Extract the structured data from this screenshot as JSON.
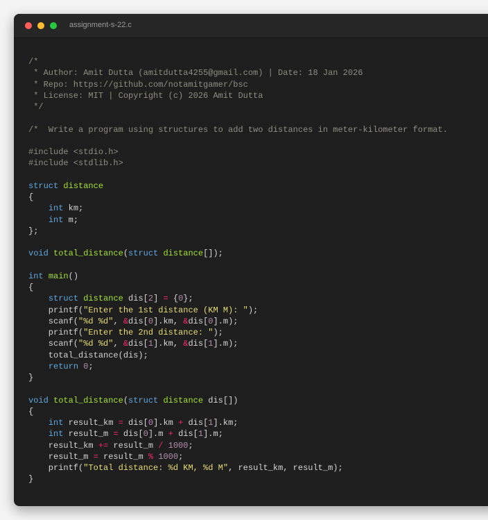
{
  "window": {
    "title": "assignment-s-22.c"
  },
  "code_lines": [
    [
      [
        "comment",
        "/*"
      ]
    ],
    [
      [
        "comment",
        " * Author: Amit Dutta (amitdutta4255@gmail.com) | Date: 18 Jan 2026"
      ]
    ],
    [
      [
        "comment",
        " * Repo: https://github.com/notamitgamer/bsc"
      ]
    ],
    [
      [
        "comment",
        " * License: MIT | Copyright (c) 2026 Amit Dutta"
      ]
    ],
    [
      [
        "comment",
        " */"
      ]
    ],
    [],
    [
      [
        "comment",
        "/*  Write a program using structures to add two distances in meter-kilometer format."
      ]
    ],
    [],
    [
      [
        "preproc",
        "#include <stdio.h>"
      ]
    ],
    [
      [
        "preproc",
        "#include <stdlib.h>"
      ]
    ],
    [],
    [
      [
        "keyword",
        "struct"
      ],
      [
        "plain",
        " "
      ],
      [
        "name",
        "distance"
      ]
    ],
    [
      [
        "punct",
        "{"
      ]
    ],
    [
      [
        "plain",
        "    "
      ],
      [
        "type",
        "int"
      ],
      [
        "plain",
        " km;"
      ]
    ],
    [
      [
        "plain",
        "    "
      ],
      [
        "type",
        "int"
      ],
      [
        "plain",
        " m;"
      ]
    ],
    [
      [
        "punct",
        "};"
      ]
    ],
    [],
    [
      [
        "type",
        "void"
      ],
      [
        "plain",
        " "
      ],
      [
        "name",
        "total_distance"
      ],
      [
        "punct",
        "("
      ],
      [
        "keyword",
        "struct"
      ],
      [
        "plain",
        " "
      ],
      [
        "name",
        "distance"
      ],
      [
        "punct",
        "[]);"
      ]
    ],
    [],
    [
      [
        "type",
        "int"
      ],
      [
        "plain",
        " "
      ],
      [
        "name",
        "main"
      ],
      [
        "punct",
        "()"
      ]
    ],
    [
      [
        "punct",
        "{"
      ]
    ],
    [
      [
        "plain",
        "    "
      ],
      [
        "keyword",
        "struct"
      ],
      [
        "plain",
        " "
      ],
      [
        "name",
        "distance"
      ],
      [
        "plain",
        " dis["
      ],
      [
        "number",
        "2"
      ],
      [
        "plain",
        "] "
      ],
      [
        "op",
        "="
      ],
      [
        "plain",
        " {"
      ],
      [
        "number",
        "0"
      ],
      [
        "plain",
        "};"
      ]
    ],
    [
      [
        "plain",
        "    printf("
      ],
      [
        "string",
        "\"Enter the 1st distance (KM M): \""
      ],
      [
        "plain",
        ");"
      ]
    ],
    [
      [
        "plain",
        "    scanf("
      ],
      [
        "string",
        "\"%d %d\""
      ],
      [
        "plain",
        ", "
      ],
      [
        "op",
        "&"
      ],
      [
        "plain",
        "dis["
      ],
      [
        "number",
        "0"
      ],
      [
        "plain",
        "].km, "
      ],
      [
        "op",
        "&"
      ],
      [
        "plain",
        "dis["
      ],
      [
        "number",
        "0"
      ],
      [
        "plain",
        "].m);"
      ]
    ],
    [
      [
        "plain",
        "    printf("
      ],
      [
        "string",
        "\"Enter the 2nd distance: \""
      ],
      [
        "plain",
        ");"
      ]
    ],
    [
      [
        "plain",
        "    scanf("
      ],
      [
        "string",
        "\"%d %d\""
      ],
      [
        "plain",
        ", "
      ],
      [
        "op",
        "&"
      ],
      [
        "plain",
        "dis["
      ],
      [
        "number",
        "1"
      ],
      [
        "plain",
        "].km, "
      ],
      [
        "op",
        "&"
      ],
      [
        "plain",
        "dis["
      ],
      [
        "number",
        "1"
      ],
      [
        "plain",
        "].m);"
      ]
    ],
    [
      [
        "plain",
        "    total_distance(dis);"
      ]
    ],
    [
      [
        "plain",
        "    "
      ],
      [
        "keyword",
        "return"
      ],
      [
        "plain",
        " "
      ],
      [
        "number",
        "0"
      ],
      [
        "plain",
        ";"
      ]
    ],
    [
      [
        "punct",
        "}"
      ]
    ],
    [],
    [
      [
        "type",
        "void"
      ],
      [
        "plain",
        " "
      ],
      [
        "name",
        "total_distance"
      ],
      [
        "punct",
        "("
      ],
      [
        "keyword",
        "struct"
      ],
      [
        "plain",
        " "
      ],
      [
        "name",
        "distance"
      ],
      [
        "plain",
        " dis[])"
      ]
    ],
    [
      [
        "punct",
        "{"
      ]
    ],
    [
      [
        "plain",
        "    "
      ],
      [
        "type",
        "int"
      ],
      [
        "plain",
        " result_km "
      ],
      [
        "op",
        "="
      ],
      [
        "plain",
        " dis["
      ],
      [
        "number",
        "0"
      ],
      [
        "plain",
        "].km "
      ],
      [
        "op",
        "+"
      ],
      [
        "plain",
        " dis["
      ],
      [
        "number",
        "1"
      ],
      [
        "plain",
        "].km;"
      ]
    ],
    [
      [
        "plain",
        "    "
      ],
      [
        "type",
        "int"
      ],
      [
        "plain",
        " result_m "
      ],
      [
        "op",
        "="
      ],
      [
        "plain",
        " dis["
      ],
      [
        "number",
        "0"
      ],
      [
        "plain",
        "].m "
      ],
      [
        "op",
        "+"
      ],
      [
        "plain",
        " dis["
      ],
      [
        "number",
        "1"
      ],
      [
        "plain",
        "].m;"
      ]
    ],
    [
      [
        "plain",
        "    result_km "
      ],
      [
        "op",
        "+="
      ],
      [
        "plain",
        " result_m "
      ],
      [
        "op",
        "/"
      ],
      [
        "plain",
        " "
      ],
      [
        "number",
        "1000"
      ],
      [
        "plain",
        ";"
      ]
    ],
    [
      [
        "plain",
        "    result_m "
      ],
      [
        "op",
        "="
      ],
      [
        "plain",
        " result_m "
      ],
      [
        "op",
        "%"
      ],
      [
        "plain",
        " "
      ],
      [
        "number",
        "1000"
      ],
      [
        "plain",
        ";"
      ]
    ],
    [
      [
        "plain",
        "    printf("
      ],
      [
        "string",
        "\"Total distance: %d KM, %d M\""
      ],
      [
        "plain",
        ", result_km, result_m);"
      ]
    ],
    [
      [
        "punct",
        "}"
      ]
    ]
  ]
}
